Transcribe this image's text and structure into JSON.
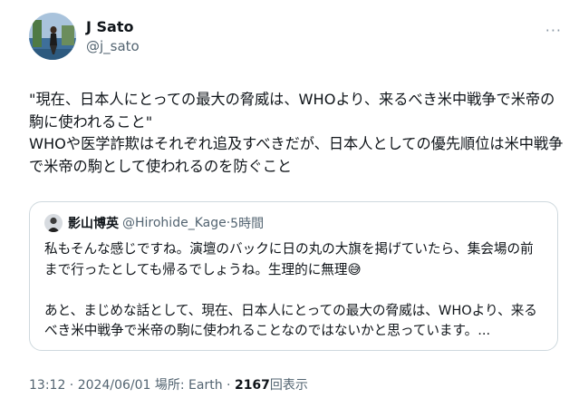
{
  "author": {
    "display_name": "J Sato",
    "handle": "@j_sato"
  },
  "more_icon_glyph": "···",
  "tweet": {
    "text": "\"現在、日本人にとっての最大の脅威は、WHOより、来るべき米中戦争で米帝の駒に使われること\"\nWHOや医学詐欺はそれぞれ追及すべきだが、日本人としての優先順位は米中戦争で米帝の駒として使われるのを防ぐこと"
  },
  "quote": {
    "display_name": "影山博英",
    "handle": "@Hirohide_Kage",
    "separator": "·",
    "time": "5時間",
    "text": "私もそんな感じですね。演壇のバックに日の丸の大旗を掲げていたら、集会場の前まで行ったとしても帰るでしょうね。生理的に無理😅\n\nあと、まじめな話として、現在、日本人にとっての最大の脅威は、WHOより、来るべき米中戦争で米帝の駒に使われることなのではないかと思っています。..."
  },
  "meta": {
    "time": "13:12",
    "sep1": " · ",
    "date": "2024/06/01",
    "location": " 場所: Earth",
    "sep2": " · ",
    "view_count": "2167",
    "views_label": "回表示"
  },
  "colors": {
    "text": "#0f1419",
    "secondary": "#536471",
    "border": "#cfd9de"
  }
}
